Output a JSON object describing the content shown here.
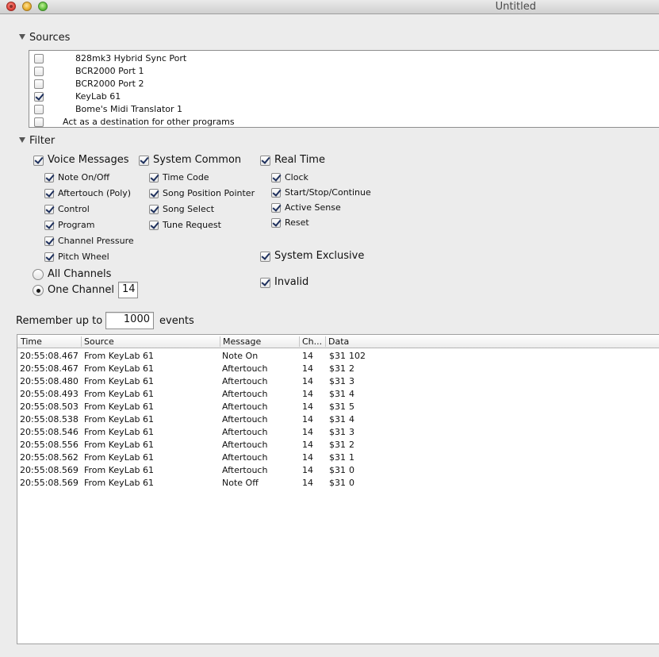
{
  "window": {
    "title": "Untitled"
  },
  "sources": {
    "header": "Sources",
    "items": [
      {
        "label": "828mk3 Hybrid Sync Port",
        "checked": false
      },
      {
        "label": "BCR2000 Port 1",
        "checked": false
      },
      {
        "label": "BCR2000 Port 2",
        "checked": false
      },
      {
        "label": "KeyLab 61",
        "checked": true
      },
      {
        "label": "Bome's Midi Translator 1",
        "checked": false
      },
      {
        "label": "Act as a destination for other programs",
        "checked": false
      }
    ]
  },
  "filter": {
    "header": "Filter",
    "voice": {
      "label": "Voice Messages",
      "checked": true,
      "items": [
        {
          "label": "Note On/Off",
          "checked": true
        },
        {
          "label": "Aftertouch (Poly)",
          "checked": true
        },
        {
          "label": "Control",
          "checked": true
        },
        {
          "label": "Program",
          "checked": true
        },
        {
          "label": "Channel Pressure",
          "checked": true
        },
        {
          "label": "Pitch Wheel",
          "checked": true
        }
      ]
    },
    "common": {
      "label": "System Common",
      "checked": true,
      "items": [
        {
          "label": "Time Code",
          "checked": true
        },
        {
          "label": "Song Position Pointer",
          "checked": true
        },
        {
          "label": "Song Select",
          "checked": true
        },
        {
          "label": "Tune Request",
          "checked": true
        }
      ]
    },
    "realtime": {
      "label": "Real Time",
      "checked": true,
      "items": [
        {
          "label": "Clock",
          "checked": true
        },
        {
          "label": "Start/Stop/Continue",
          "checked": true
        },
        {
          "label": "Active Sense",
          "checked": true
        },
        {
          "label": "Reset",
          "checked": true
        }
      ]
    },
    "sysex": {
      "label": "System Exclusive",
      "checked": true
    },
    "invalid": {
      "label": "Invalid",
      "checked": true
    },
    "channels": {
      "all_label": "All Channels",
      "one_label": "One Channel",
      "selected": "one",
      "channel_value": "14"
    }
  },
  "remember": {
    "prefix": "Remember up to",
    "value": "1000",
    "suffix": "events"
  },
  "events": {
    "columns": [
      "Time",
      "Source",
      "Message",
      "Ch...",
      "Data"
    ],
    "rows": [
      [
        "20:55:08.467",
        "From KeyLab 61",
        "Note On",
        "14",
        "$31",
        "102"
      ],
      [
        "20:55:08.467",
        "From KeyLab 61",
        "Aftertouch",
        "14",
        "$31",
        "2"
      ],
      [
        "20:55:08.480",
        "From KeyLab 61",
        "Aftertouch",
        "14",
        "$31",
        "3"
      ],
      [
        "20:55:08.493",
        "From KeyLab 61",
        "Aftertouch",
        "14",
        "$31",
        "4"
      ],
      [
        "20:55:08.503",
        "From KeyLab 61",
        "Aftertouch",
        "14",
        "$31",
        "5"
      ],
      [
        "20:55:08.538",
        "From KeyLab 61",
        "Aftertouch",
        "14",
        "$31",
        "4"
      ],
      [
        "20:55:08.546",
        "From KeyLab 61",
        "Aftertouch",
        "14",
        "$31",
        "3"
      ],
      [
        "20:55:08.556",
        "From KeyLab 61",
        "Aftertouch",
        "14",
        "$31",
        "2"
      ],
      [
        "20:55:08.562",
        "From KeyLab 61",
        "Aftertouch",
        "14",
        "$31",
        "1"
      ],
      [
        "20:55:08.569",
        "From KeyLab 61",
        "Aftertouch",
        "14",
        "$31",
        "0"
      ],
      [
        "20:55:08.569",
        "From KeyLab 61",
        "Note Off",
        "14",
        "$31",
        "0"
      ]
    ]
  }
}
